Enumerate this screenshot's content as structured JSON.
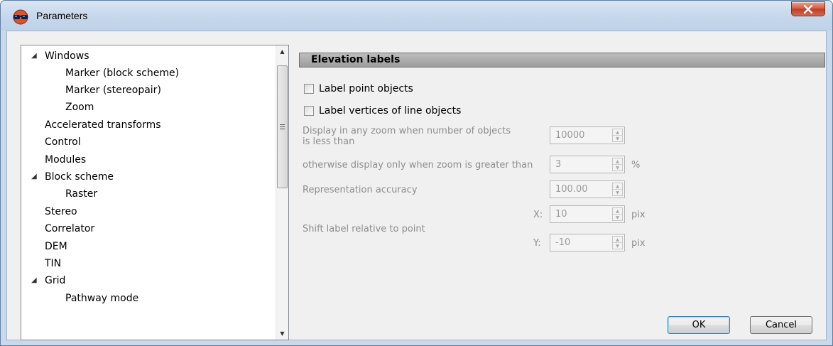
{
  "window": {
    "title": "Parameters",
    "icon": "3d-glasses-icon",
    "close_icon": "close-icon"
  },
  "tree": {
    "items": [
      {
        "label": "Windows",
        "level": 0,
        "expanded": true
      },
      {
        "label": "Marker (block scheme)",
        "level": 1
      },
      {
        "label": "Marker (stereopair)",
        "level": 1
      },
      {
        "label": "Zoom",
        "level": 1
      },
      {
        "label": "Accelerated transforms",
        "level": 0
      },
      {
        "label": "Control",
        "level": 0
      },
      {
        "label": "Modules",
        "level": 0
      },
      {
        "label": "Block scheme",
        "level": 0,
        "expanded": true
      },
      {
        "label": "Raster",
        "level": 1
      },
      {
        "label": "Stereo",
        "level": 0
      },
      {
        "label": "Correlator",
        "level": 0
      },
      {
        "label": "DEM",
        "level": 0
      },
      {
        "label": "TIN",
        "level": 0
      },
      {
        "label": "Grid",
        "level": 0,
        "expanded": true
      },
      {
        "label": "Pathway mode",
        "level": 1
      }
    ]
  },
  "panel": {
    "header": "Elevation labels",
    "label_point_objects": "Label point objects",
    "label_vertices": "Label vertices of line objects",
    "display_any_zoom_label": "Display in any zoom when number of objects is less than",
    "display_any_zoom_value": "10000",
    "otherwise_label": "otherwise display only when zoom is greater than",
    "otherwise_value": "3",
    "otherwise_unit": "%",
    "accuracy_label": "Representation accuracy",
    "accuracy_value": "100.00",
    "shift_label": "Shift label relative to point",
    "shift_x_label": "X:",
    "shift_x_value": "10",
    "shift_y_label": "Y:",
    "shift_y_value": "-10",
    "shift_unit": "pix"
  },
  "buttons": {
    "ok": "OK",
    "cancel": "Cancel"
  }
}
